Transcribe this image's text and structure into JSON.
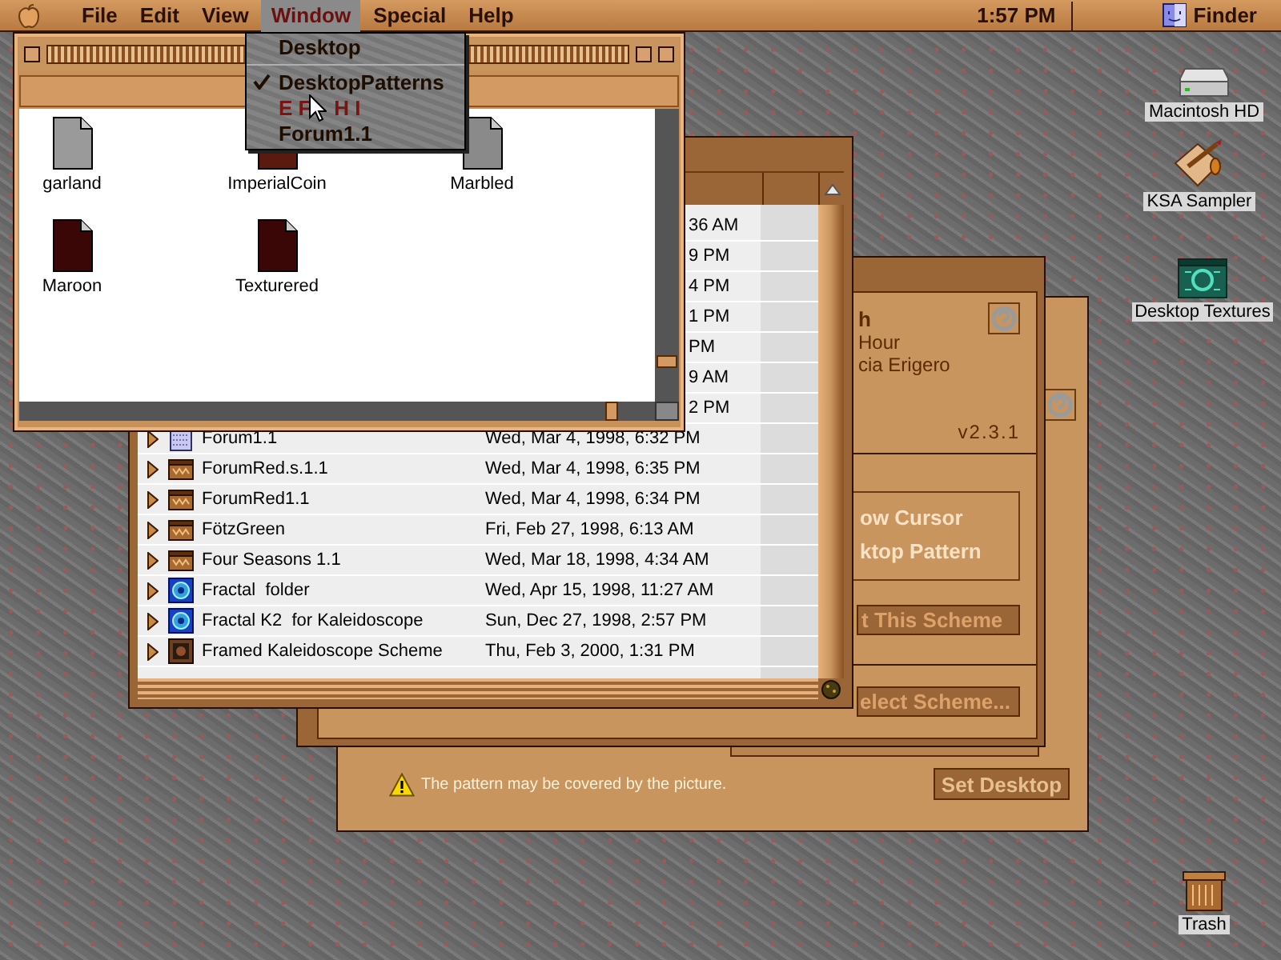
{
  "menu_bar": {
    "menus": [
      {
        "label": "File",
        "selected": false
      },
      {
        "label": "Edit",
        "selected": false
      },
      {
        "label": "View",
        "selected": false
      },
      {
        "label": "Window",
        "selected": true
      },
      {
        "label": "Special",
        "selected": false
      },
      {
        "label": "Help",
        "selected": false
      }
    ],
    "clock": "1:57 PM",
    "app": "Finder"
  },
  "window_menu": {
    "items": [
      {
        "kind": "item",
        "label": "Desktop",
        "checked": false,
        "color": "#1e0e02"
      },
      {
        "kind": "separator"
      },
      {
        "kind": "item",
        "label": "DesktopPatterns",
        "checked": true,
        "color": "#1e0e02"
      },
      {
        "kind": "item",
        "label": "E F    H I",
        "checked": false,
        "color": "#7a1414"
      },
      {
        "kind": "item",
        "label": "Forum1.1",
        "checked": false,
        "color": "#1e0e02"
      }
    ]
  },
  "icon_window": {
    "icons": [
      {
        "name": "garland",
        "color": "#9a9a9a"
      },
      {
        "name": "ImperialCoin",
        "color": "#5a1a10"
      },
      {
        "name": "Marbled",
        "color": "#8a8a8a"
      },
      {
        "name": "Maroon",
        "color": "#3a0606"
      },
      {
        "name": "Texturered",
        "color": "#3a0606"
      }
    ]
  },
  "list_window": {
    "rows": [
      {
        "kind": "covered",
        "date": "36 AM"
      },
      {
        "kind": "covered",
        "date": "9 PM"
      },
      {
        "kind": "covered",
        "date": "4 PM"
      },
      {
        "kind": "covered",
        "date": "1 PM"
      },
      {
        "kind": "covered",
        "date": "PM"
      },
      {
        "kind": "covered",
        "date": "9 AM"
      },
      {
        "kind": "covered",
        "date": "2 PM"
      },
      {
        "kind": "pattern",
        "name": "Forum1.1",
        "date": "Wed, Mar 4, 1998, 6:32 PM"
      },
      {
        "kind": "scheme",
        "name": "ForumRed.s.1.1",
        "date": "Wed, Mar 4, 1998, 6:35 PM"
      },
      {
        "kind": "scheme",
        "name": "ForumRed1.1",
        "date": "Wed, Mar 4, 1998, 6:34 PM"
      },
      {
        "kind": "scheme",
        "name": "FötzGreen",
        "date": "Fri, Feb 27, 1998, 6:13 AM"
      },
      {
        "kind": "scheme",
        "name": "Four Seasons 1.1",
        "date": "Wed, Mar 18, 1998, 4:34 AM"
      },
      {
        "kind": "fractal",
        "name": "Fractal  folder",
        "date": "Wed, Apr 15, 1998, 11:27 AM"
      },
      {
        "kind": "fractal",
        "name": "Fractal K2  for Kaleidoscope",
        "date": "Sun, Dec 27, 1998, 2:57 PM"
      },
      {
        "kind": "framed",
        "name": "Framed Kaleidoscope Scheme",
        "date": "Thu, Feb 3, 2000, 1:31 PM"
      }
    ]
  },
  "scheme_window": {
    "title": "h",
    "lines": [
      "Hour",
      "cia Erigero"
    ],
    "version": "v2.3.1",
    "options": [
      "ow Cursor",
      "ktop Pattern"
    ],
    "buttons": [
      "t This Scheme",
      "elect Scheme..."
    ]
  },
  "desktop_window": {
    "warning": "The pattern may be covered by the picture.",
    "button": "Set Desktop"
  },
  "desktop_icons": [
    {
      "kind": "disk",
      "label": "Macintosh HD"
    },
    {
      "kind": "app",
      "label": "KSA Sampler"
    },
    {
      "kind": "folder",
      "label": "Desktop Textures"
    },
    {
      "kind": "trash",
      "label": "Trash"
    }
  ]
}
